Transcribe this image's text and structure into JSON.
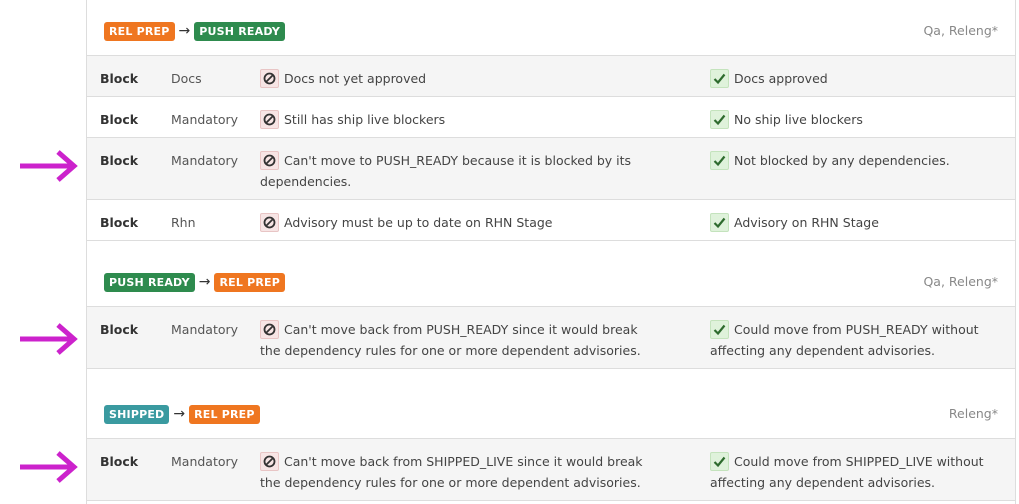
{
  "colors": {
    "rel_prep": "#ef7620",
    "push_ready": "#2e8b4e",
    "shipped": "#3a9aa0",
    "pointer_arrow": "#cc22cc"
  },
  "sections": [
    {
      "from": "REL PREP",
      "to": "PUSH READY",
      "roles": "Qa, Releng*",
      "rows": [
        {
          "type": "Block",
          "category": "Docs",
          "fail": "Docs not yet approved",
          "pass": "Docs approved"
        },
        {
          "type": "Block",
          "category": "Mandatory",
          "fail": "Still has ship live blockers",
          "pass": "No ship live blockers"
        },
        {
          "type": "Block",
          "category": "Mandatory",
          "fail": "Can't move to PUSH_READY because it is blocked by its dependencies.",
          "pass": "Not blocked by any dependencies."
        },
        {
          "type": "Block",
          "category": "Rhn",
          "fail": "Advisory must be up to date on RHN Stage",
          "pass": "Advisory on RHN Stage"
        }
      ]
    },
    {
      "from": "PUSH READY",
      "to": "REL PREP",
      "roles": "Qa, Releng*",
      "rows": [
        {
          "type": "Block",
          "category": "Mandatory",
          "fail": "Can't move back from PUSH_READY since it would break the dependency rules for one or more dependent advisories.",
          "pass": "Could move from PUSH_READY without affecting any dependent advisories."
        }
      ]
    },
    {
      "from": "SHIPPED",
      "to": "REL PREP",
      "roles": "Releng*",
      "rows": [
        {
          "type": "Block",
          "category": "Mandatory",
          "fail": "Can't move back from SHIPPED_LIVE since it would break the dependency rules for one or more dependent advisories.",
          "pass": "Could move from SHIPPED_LIVE without affecting any dependent advisories."
        }
      ]
    }
  ]
}
